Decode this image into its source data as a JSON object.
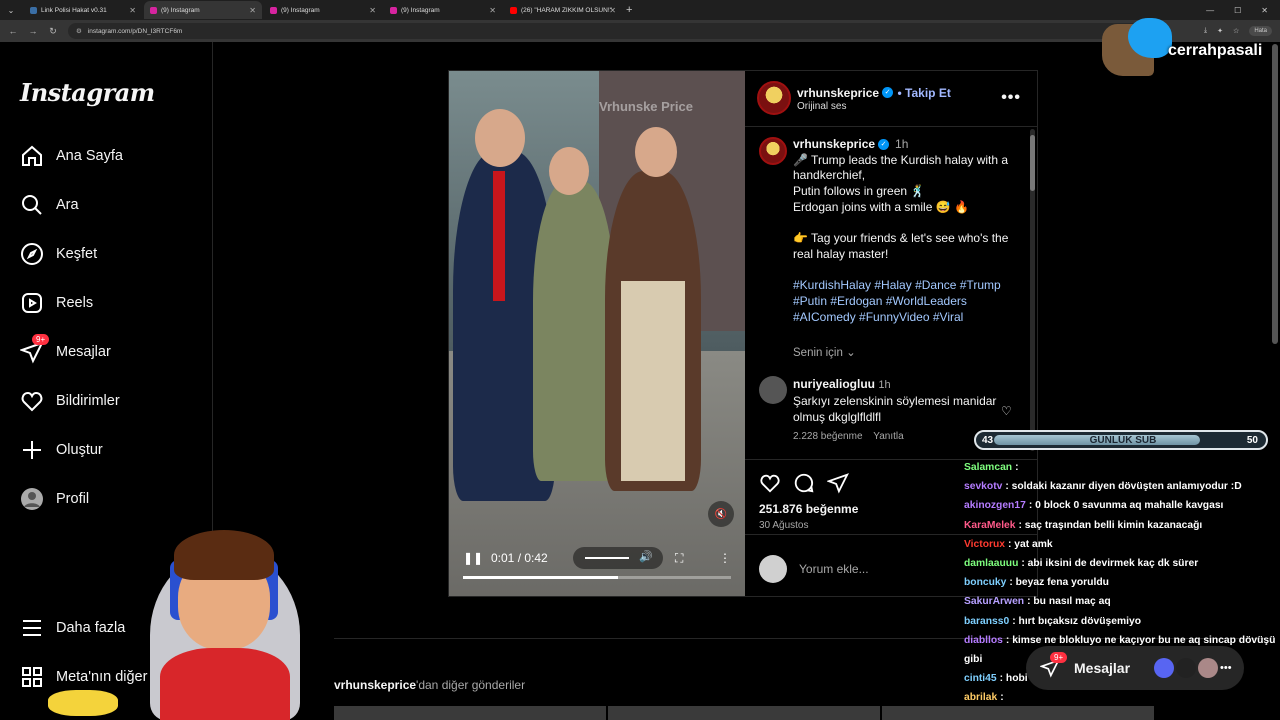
{
  "browser": {
    "tabs": [
      {
        "title": "Link Polisi Hakat v0.31",
        "color": "#3a6ea5",
        "active": false
      },
      {
        "title": "(9) Instagram",
        "color": "#d6249f",
        "active": true
      },
      {
        "title": "(9) Instagram",
        "color": "#d6249f",
        "active": false
      },
      {
        "title": "(9) Instagram",
        "color": "#d6249f",
        "active": false
      },
      {
        "title": "(26) \"HARAM ZIKKIM OLSUN!\"",
        "color": "#ff0000",
        "active": false
      }
    ],
    "url": "instagram.com/p/DN_I3RTCF6m",
    "profile_label": "Hata"
  },
  "sidebar": {
    "logo": "Instagram",
    "items": [
      {
        "label": "Ana Sayfa",
        "icon": "home-icon"
      },
      {
        "label": "Ara",
        "icon": "search-icon"
      },
      {
        "label": "Keşfet",
        "icon": "compass-icon"
      },
      {
        "label": "Reels",
        "icon": "reels-icon"
      },
      {
        "label": "Mesajlar",
        "icon": "messenger-icon",
        "badge": "9+"
      },
      {
        "label": "Bildirimler",
        "icon": "heart-icon"
      },
      {
        "label": "Oluştur",
        "icon": "plus-icon"
      },
      {
        "label": "Profil",
        "icon": "avatar-icon"
      }
    ],
    "more": "Daha fazla",
    "meta": "Meta'nın diğer ür"
  },
  "post": {
    "username": "vrhunskeprice",
    "follow": "Takip Et",
    "audio": "Orijinal ses",
    "caption_time": "1h",
    "caption_lines": [
      "🎤 Trump leads the Kurdish halay with a handkerchief,",
      "Putin follows in green 🕺",
      "Erdogan joins with a smile 😅 🔥",
      "",
      "👉 Tag your friends & let's see who's the real halay master!"
    ],
    "hashtags": "#KurdishHalay #Halay #Dance #Trump #Putin #Erdogan #WorldLeaders #AIComedy #FunnyVideo #Viral",
    "senin_icin": "Senin için",
    "comment": {
      "user": "nuriyealiogluu",
      "time": "1h",
      "text": "Şarkıyı zelenskinin söylemesi manidar olmuş dkglglfldlfl",
      "likes": "2.228 beğenme",
      "reply": "Yanıtla"
    },
    "likes": "251.876 beğenme",
    "date": "30 Ağustos",
    "add_comment": "Yorum ekle...",
    "video": {
      "time": "0:01 / 0:42",
      "progress": 0.58,
      "watermark": "Vrhunske Price"
    }
  },
  "more_posts": {
    "user": "vrhunskeprice",
    "suffix": "'dan diğer gönderiler"
  },
  "overlay": {
    "twitter_handle": "cerrahpasali",
    "goal": {
      "current": "43",
      "label": "GÜNLÜK SUB",
      "target": "50",
      "fill": 0.86
    },
    "chat": [
      {
        "user": "Salamcan",
        "color": "#7fff7f",
        "text": ":"
      },
      {
        "user": "sevkotv",
        "color": "#b57cff",
        "text": ": soldaki kazanır diyen dövüşten anlamıyodur :D"
      },
      {
        "user": "akinozgen17",
        "color": "#b57cff",
        "text": ": 0 block 0 savunma aq mahalle kavgası"
      },
      {
        "user": "KaraMelek",
        "color": "#ff5a8a",
        "text": ": saç traşından belli kimin kazanacağı"
      },
      {
        "user": "Victorux",
        "color": "#ff3b30",
        "text": ": yat amk"
      },
      {
        "user": "damlaauuu",
        "color": "#7fff7f",
        "text": ": abi iksini de devirmek kaç dk sürer"
      },
      {
        "user": "boncuky",
        "color": "#7fd0ff",
        "text": ": beyaz fena yoruldu"
      },
      {
        "user": "SakurArwen",
        "color": "#b7a0ff",
        "text": ": bu nasıl maç aq"
      },
      {
        "user": "baranss0",
        "color": "#7fd0ff",
        "text": ": hırt bıçaksız dövüşemiyo"
      },
      {
        "user": "diabllos",
        "color": "#b57cff",
        "text": ": kimse ne blokluyo ne kaçıyor bu ne aq sincap dövüşü"
      },
      {
        "user": "",
        "color": "#ffffff",
        "text": "gibi"
      },
      {
        "user": "cinti45",
        "color": "#7fd0ff",
        "text": ": hobi"
      },
      {
        "user": "abrilak",
        "color": "#ffcc66",
        "text": ":"
      }
    ]
  },
  "messages_pill": {
    "label": "Mesajlar",
    "badge": "9+"
  }
}
